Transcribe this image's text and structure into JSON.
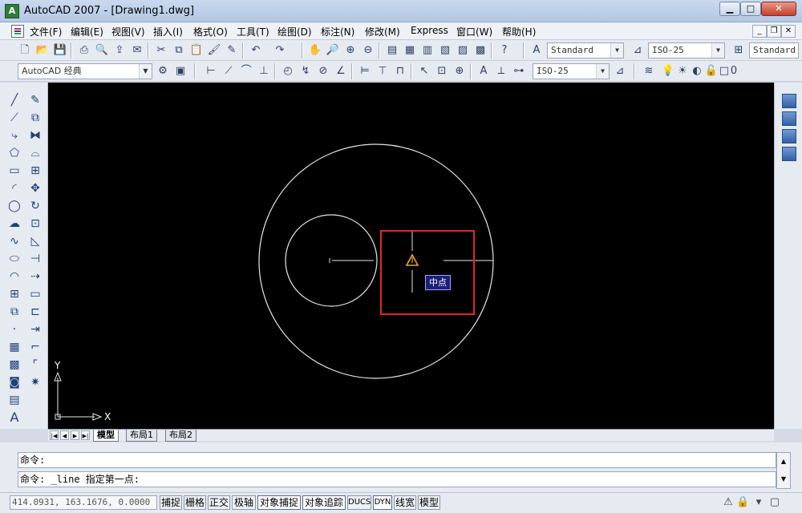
{
  "window": {
    "title": "AutoCAD 2007 - [Drawing1.dwg]",
    "icon": "autocad-logo-icon",
    "min_label": "▁",
    "max_label": "□",
    "close_label": "✕"
  },
  "menu": {
    "items": [
      "文件(F)",
      "编辑(E)",
      "视图(V)",
      "插入(I)",
      "格式(O)",
      "工具(T)",
      "绘图(D)",
      "标注(N)",
      "修改(M)",
      "Express",
      "窗口(W)",
      "帮助(H)"
    ],
    "mdi_controls": [
      "_",
      "❐",
      "✕"
    ]
  },
  "toolbar1": {
    "text_style": "Standard",
    "dim_style": "ISO-25",
    "table_style": "Standard"
  },
  "toolbar2": {
    "workspace": "AutoCAD 经典",
    "dim_style": "ISO-25",
    "layer_value": "0"
  },
  "canvas": {
    "background": "#000000",
    "snap_tooltip": "中点",
    "axis_x_label": "X",
    "axis_y_label": "Y",
    "highlight_color": "#e0262c"
  },
  "tabs": {
    "nav": [
      "|◀",
      "◀",
      "▶",
      "▶|"
    ],
    "items": [
      "模型",
      "布局1",
      "布局2"
    ],
    "active": "模型"
  },
  "command": {
    "line1": "命令:",
    "line2": "命令: _line 指定第一点:"
  },
  "status": {
    "coordinates": "414.0931, 163.1676, 0.0000",
    "toggles": [
      "捕捉",
      "栅格",
      "正交",
      "极轴",
      "对象捕捉",
      "对象追踪",
      "DUCS",
      "DYN",
      "线宽",
      "模型"
    ]
  }
}
